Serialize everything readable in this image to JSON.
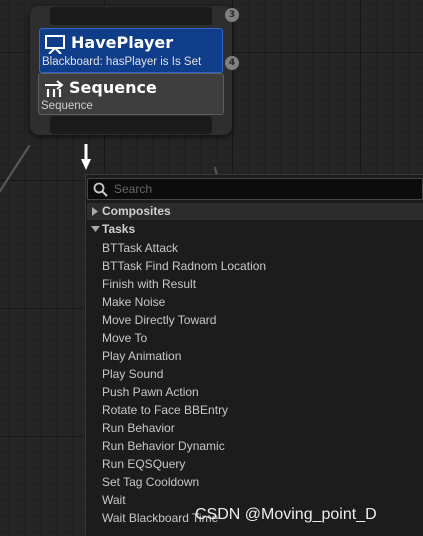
{
  "graph": {
    "node": {
      "decorator": {
        "title": "HavePlayer",
        "subtitle": "Blackboard: hasPlayer is Is Set",
        "index": "4",
        "icon": "decorator-icon"
      },
      "composite": {
        "title": "Sequence",
        "subtitle": "Sequence",
        "index": "3",
        "icon": "sequence-icon"
      }
    }
  },
  "menu": {
    "search": {
      "placeholder": "Search",
      "value": "",
      "icon": "search-icon"
    },
    "categories": [
      {
        "label": "Composites",
        "expanded": false
      },
      {
        "label": "Tasks",
        "expanded": true
      }
    ],
    "tasks": [
      "BTTask Attack",
      "BTTask Find Radnom Location",
      "Finish with Result",
      "Make Noise",
      "Move Directly Toward",
      "Move To",
      "Play Animation",
      "Play Sound",
      "Push Pawn Action",
      "Rotate to Face BBEntry",
      "Run Behavior",
      "Run Behavior Dynamic",
      "Run EQSQuery",
      "Set Tag Cooldown",
      "Wait",
      "Wait Blackboard Time"
    ]
  },
  "watermark": "CSDN @Moving_point_D",
  "colors": {
    "decorator_bg": "#103d8a",
    "decorator_border": "#2f67c9",
    "composite_bg": "#3e3e3e",
    "node_bg": "#2e2e2e",
    "graph_bg": "#252525",
    "menu_bg": "#1c1c1c"
  }
}
